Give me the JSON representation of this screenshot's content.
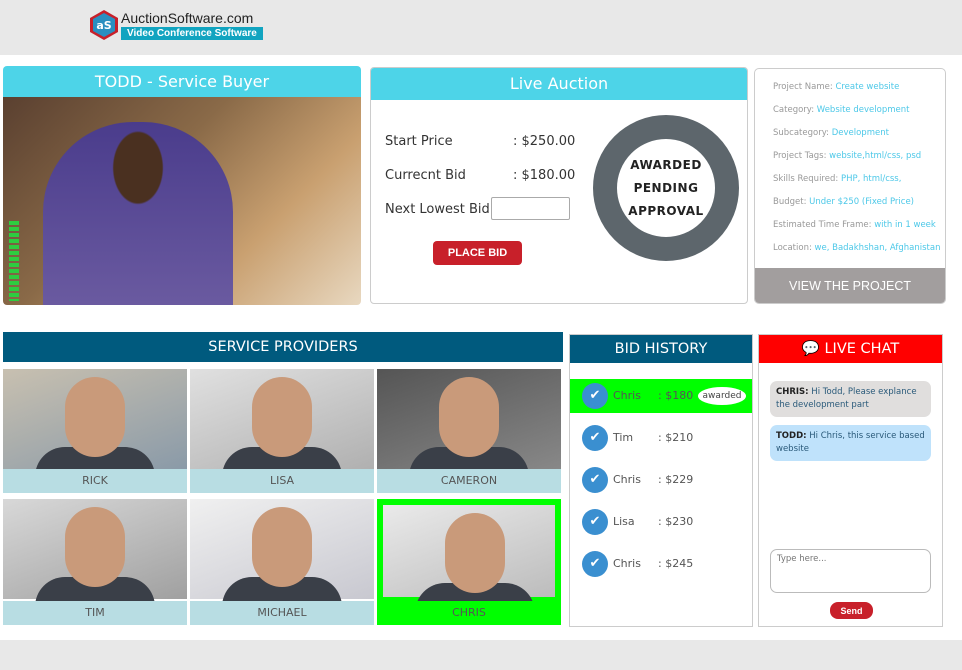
{
  "header": {
    "logo_name": "AuctionSoftware.com",
    "logo_sub": "Video Conference Software",
    "logo_mark": "aS"
  },
  "buyer": {
    "title": "TODD - Service Buyer"
  },
  "auction": {
    "title": "Live Auction",
    "start_label": "Start Price",
    "start_value": ": $250.00",
    "current_label": "Currecnt Bid",
    "current_value": ": $180.00",
    "next_label": "Next Lowest Bid",
    "next_value": "",
    "place_bid": "PLACE BID",
    "status": [
      "AWARDED",
      "PENDING",
      "APPROVAL"
    ]
  },
  "project": {
    "fields": [
      {
        "label": "Project Name:",
        "value": "Create website"
      },
      {
        "label": "Category:",
        "value": "Website development"
      },
      {
        "label": "Subcategory:",
        "value": "Development"
      },
      {
        "label": "Project Tags:",
        "value": "website,html/css, psd"
      },
      {
        "label": "Skills Required:",
        "value": "PHP, html/css,"
      },
      {
        "label": "Budget:",
        "value": "Under $250 (Fixed Price)"
      },
      {
        "label": "Estimated Time Frame:",
        "value": "with in 1 week"
      },
      {
        "label": "Location:",
        "value": "we, Badakhshan, Afghanistan"
      }
    ],
    "view_button": "VIEW THE PROJECT"
  },
  "providers": {
    "title": "SERVICE PROVIDERS",
    "items": [
      {
        "name": "RICK"
      },
      {
        "name": "LISA"
      },
      {
        "name": "CAMERON"
      },
      {
        "name": "TIM"
      },
      {
        "name": "MICHAEL"
      },
      {
        "name": "CHRIS",
        "selected": true
      }
    ]
  },
  "bid_history": {
    "title": "BID HISTORY",
    "items": [
      {
        "name": "Chris",
        "amount": ": $180",
        "badge": "awarded"
      },
      {
        "name": "Tim",
        "amount": ": $210"
      },
      {
        "name": "Chris",
        "amount": ": $229"
      },
      {
        "name": "Lisa",
        "amount": ": $230"
      },
      {
        "name": "Chris",
        "amount": ": $245"
      }
    ]
  },
  "chat": {
    "title": "LIVE CHAT",
    "messages": [
      {
        "sender": "CHRIS:",
        "text": "Hi Todd, Please explance the development part"
      },
      {
        "sender": "TODD:",
        "text": "Hi Chris, this service based website"
      }
    ],
    "placeholder": "Type here...",
    "send": "Send"
  },
  "colors": {
    "cyan": "#4dd4e8",
    "navy": "#005a7e",
    "red": "#ff0000",
    "green": "#00ff00",
    "button_red": "#c8202a"
  }
}
